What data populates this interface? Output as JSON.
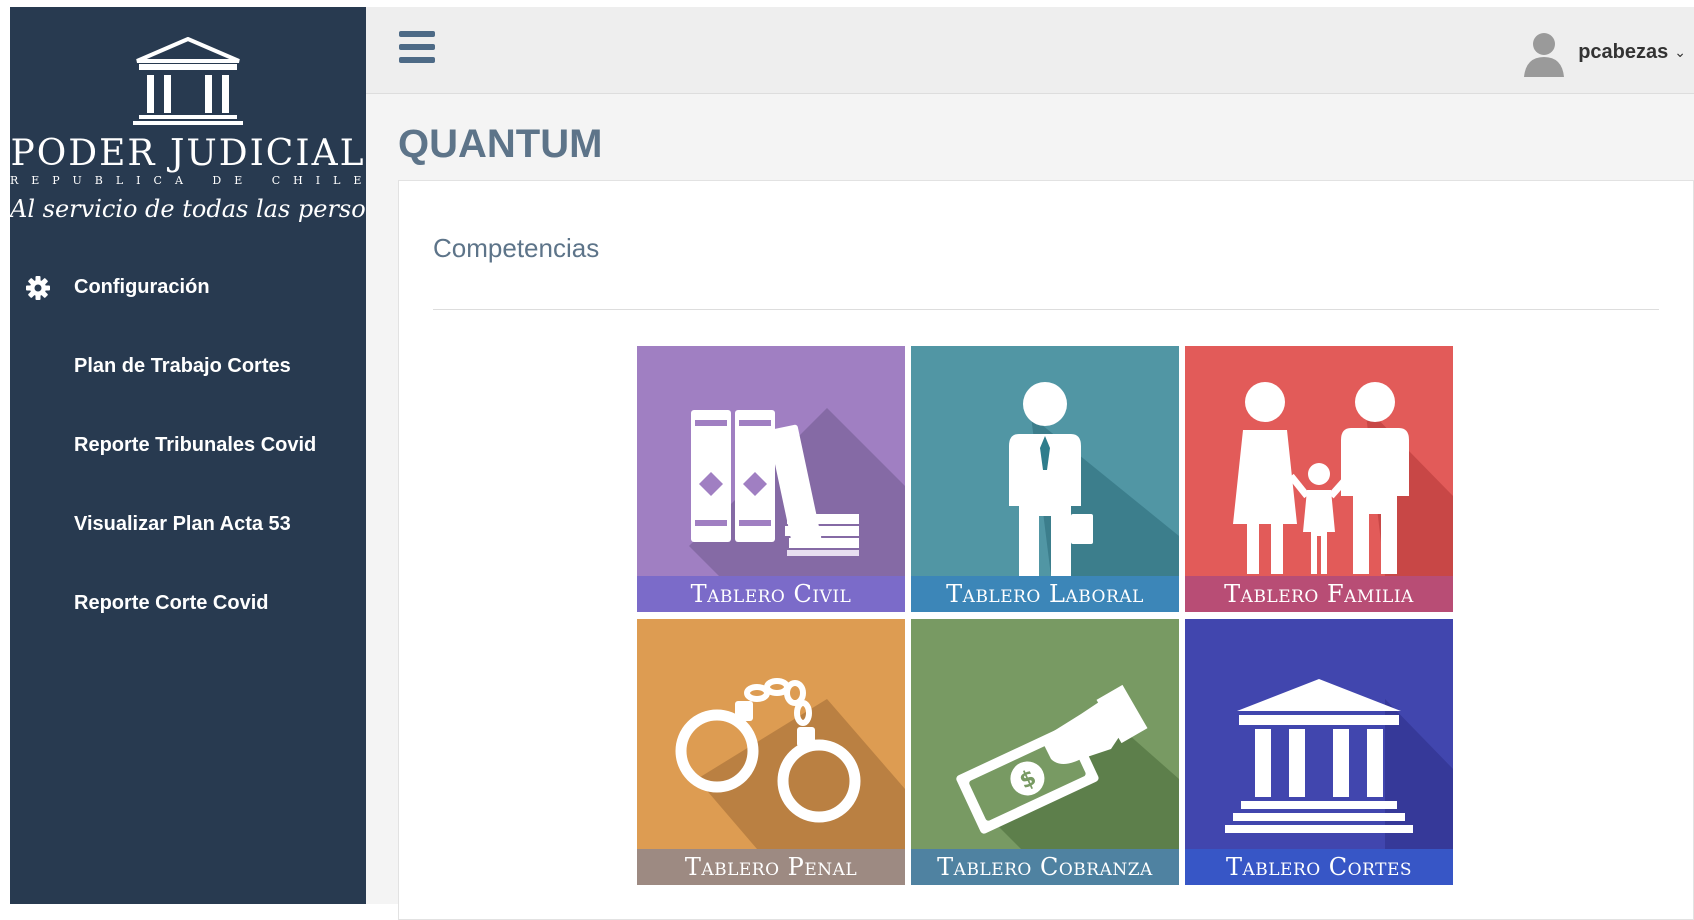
{
  "sidebar": {
    "logo": {
      "title": "PODER JUDICIAL",
      "subtitle": "REPUBLICA DE CHILE",
      "motto": "Al servicio de todas las personas"
    },
    "items": [
      {
        "label": "Configuración",
        "icon": "gear-icon"
      },
      {
        "label": "Plan de Trabajo Cortes"
      },
      {
        "label": "Reporte Tribunales Covid"
      },
      {
        "label": "Visualizar Plan Acta 53"
      },
      {
        "label": "Reporte Corte Covid"
      }
    ]
  },
  "header": {
    "menu_icon": "hamburger-icon",
    "user": {
      "name": "pcabezas",
      "avatar": "user-avatar-icon"
    }
  },
  "main": {
    "title": "QUANTUM",
    "panel_title": "Competencias",
    "tiles": [
      {
        "label": "Tablero Civil",
        "icon": "binders-icon",
        "color": "#a07fc2",
        "band": "#7b6bc9"
      },
      {
        "label": "Tablero Laboral",
        "icon": "worker-icon",
        "color": "#5196a4",
        "band": "#3c86b8"
      },
      {
        "label": "Tablero Familia",
        "icon": "family-icon",
        "color": "#e25b59",
        "band": "#b84d75"
      },
      {
        "label": "Tablero Penal",
        "icon": "handcuffs-icon",
        "color": "#dd9c52",
        "band": "#9d8a82"
      },
      {
        "label": "Tablero Cobranza",
        "icon": "money-hand-icon",
        "color": "#789a63",
        "band": "#4f82a1"
      },
      {
        "label": "Tablero Cortes",
        "icon": "courthouse-icon",
        "color": "#4146ae",
        "band": "#3756c6"
      }
    ]
  }
}
